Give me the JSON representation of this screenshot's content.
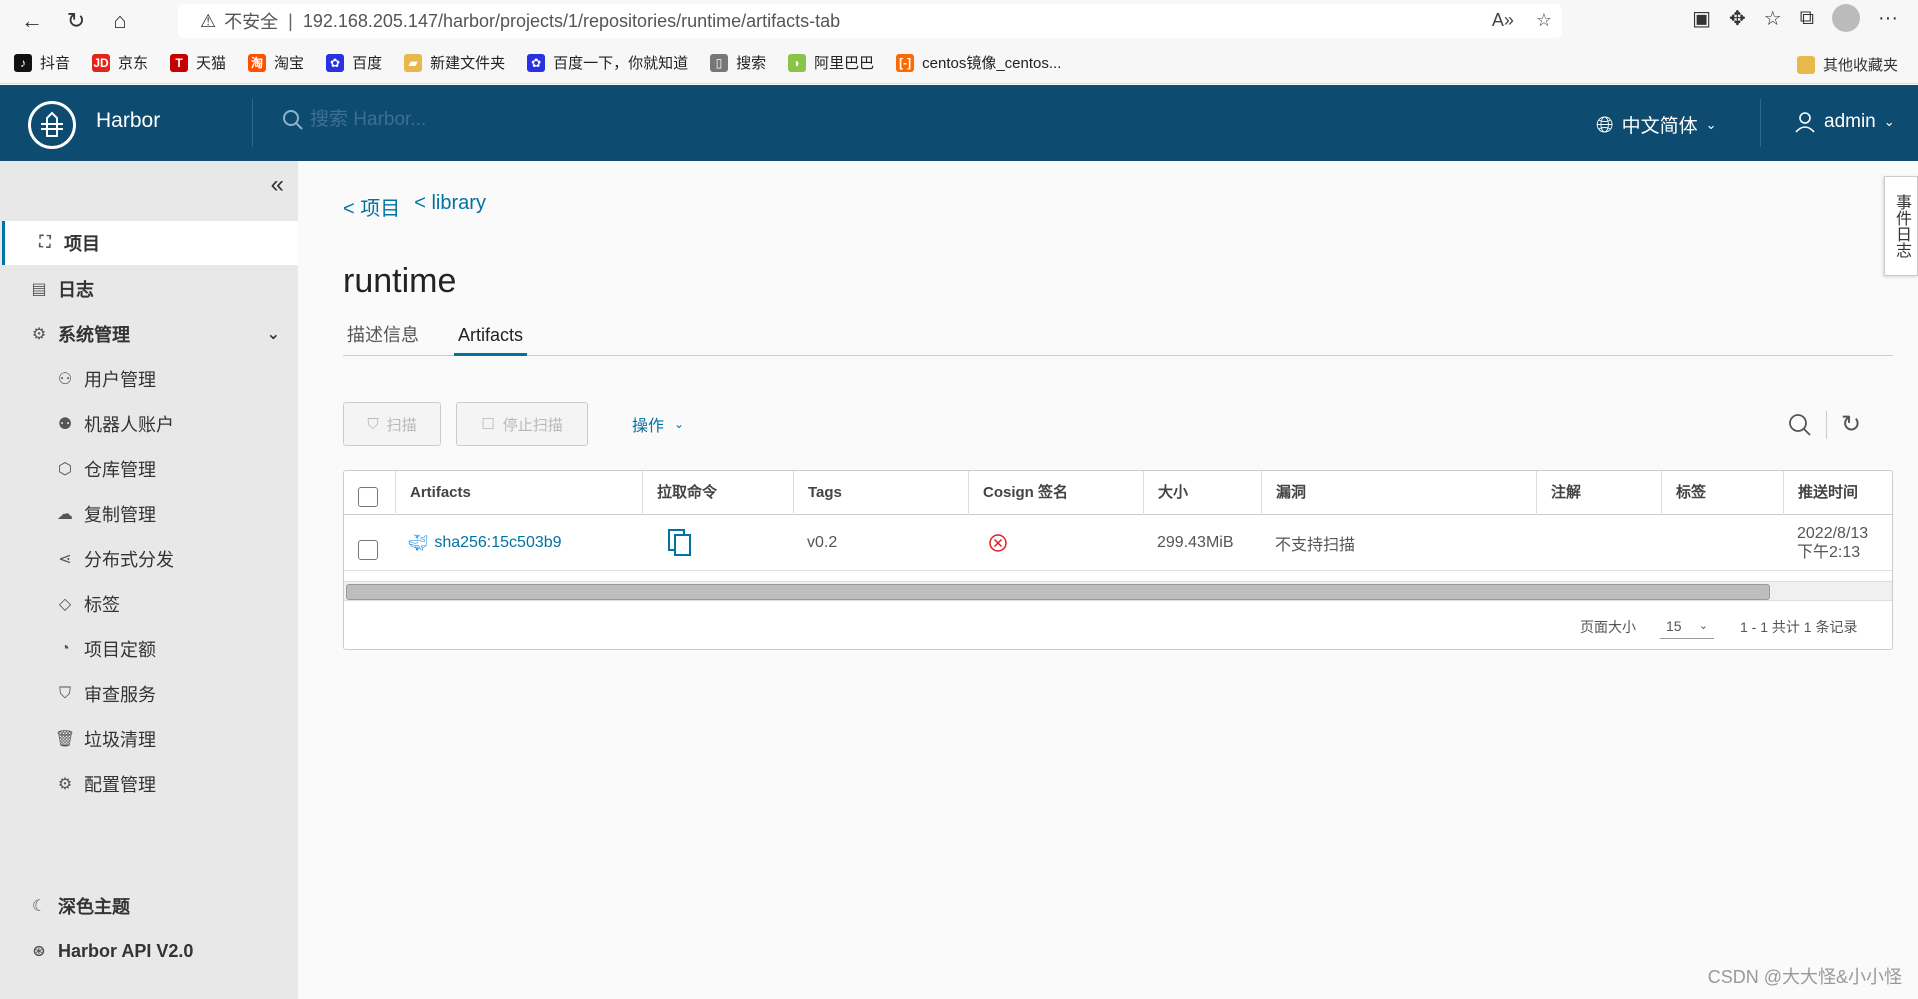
{
  "browser": {
    "insecure_label": "不安全",
    "separator": "|",
    "url": "192.168.205.147/harbor/projects/1/repositories/runtime/artifacts-tab"
  },
  "bookmarks": [
    {
      "label": "抖音",
      "color": "#111111",
      "glyph": "♪"
    },
    {
      "label": "京东",
      "color": "#e1251b",
      "glyph": "JD"
    },
    {
      "label": "天猫",
      "color": "#c40000",
      "glyph": "T"
    },
    {
      "label": "淘宝",
      "color": "#ff5000",
      "glyph": "淘"
    },
    {
      "label": "百度",
      "color": "#2932e1",
      "glyph": "✿"
    },
    {
      "label": "新建文件夹",
      "color": "#e8b84a",
      "glyph": "▰"
    },
    {
      "label": "百度一下，你就知道",
      "color": "#2932e1",
      "glyph": "✿"
    },
    {
      "label": "搜索",
      "color": "#777777",
      "glyph": "▯"
    },
    {
      "label": "阿里巴巴",
      "color": "#8bc34a",
      "glyph": "◗"
    },
    {
      "label": "centos镜像_centos...",
      "color": "#ff6a00",
      "glyph": "[-]"
    }
  ],
  "bookmarks_other": "其他收藏夹",
  "header": {
    "brand": "Harbor",
    "search_placeholder": "搜索 Harbor...",
    "language": "中文简体",
    "user": "admin",
    "bg_color": "#0d4b70"
  },
  "sidebar": {
    "items": [
      {
        "label": "项目",
        "icon": "project-icon"
      },
      {
        "label": "日志",
        "icon": "log-icon"
      },
      {
        "label": "系统管理",
        "icon": "admin-icon"
      },
      {
        "label": "用户管理",
        "icon": "users-icon"
      },
      {
        "label": "机器人账户",
        "icon": "robot-icon"
      },
      {
        "label": "仓库管理",
        "icon": "registry-icon"
      },
      {
        "label": "复制管理",
        "icon": "replication-icon"
      },
      {
        "label": "分布式分发",
        "icon": "share-icon"
      },
      {
        "label": "标签",
        "icon": "tag-icon"
      },
      {
        "label": "项目定额",
        "icon": "quota-icon"
      },
      {
        "label": "审查服务",
        "icon": "shield-icon"
      },
      {
        "label": "垃圾清理",
        "icon": "trash-icon"
      },
      {
        "label": "配置管理",
        "icon": "gear-icon"
      }
    ],
    "dark_theme": "深色主题",
    "api": "Harbor API V2.0"
  },
  "event_tab": "事件日志",
  "breadcrumb": {
    "projects": "< 项目",
    "library": "< library"
  },
  "page_title": "runtime",
  "tabs": [
    {
      "label": "描述信息"
    },
    {
      "label": "Artifacts"
    }
  ],
  "toolbar": {
    "scan": "扫描",
    "stop_scan": "停止扫描",
    "actions": "操作"
  },
  "table": {
    "columns": [
      "Artifacts",
      "拉取命令",
      "Tags",
      "Cosign 签名",
      "大小",
      "漏洞",
      "注解",
      "标签",
      "推送时间"
    ],
    "rows": [
      {
        "artifact": "sha256:15c503b9",
        "tags": "v0.2",
        "size": "299.43MiB",
        "vulnerability": "不支持扫描",
        "push_date": "2022/8/13",
        "push_time": "下午2:13"
      }
    ],
    "page_size_label": "页面大小",
    "page_size": "15",
    "total": "1 - 1 共计 1 条记录"
  },
  "watermark": "CSDN @大大怪&小小怪",
  "colors": {
    "accent": "#0072a3",
    "error": "#e02020"
  }
}
